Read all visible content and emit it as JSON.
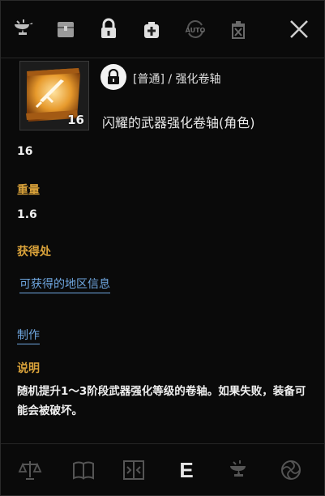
{
  "header": {
    "category": "[普通] / 强化卷轴",
    "item_name": "闪耀的武器强化卷轴(角色)",
    "item_count": "16",
    "auto_label": "AUTO"
  },
  "stats": {
    "quantity": "16",
    "weight_label": "重量",
    "weight_value": "1.6",
    "source_label": "获得处",
    "source_link": "可获得的地区信息",
    "craft_link": "制作",
    "desc_label": "说明",
    "desc_text": "随机提升1～3阶段武器强化等级的卷轴。如果失败，装备可能会被破坏。"
  },
  "bottom": {
    "e_label": "E"
  },
  "colors": {
    "label": "#d9a23a",
    "link": "#6fa7e0",
    "icon": "#bdbdbd",
    "scroll": "#e79a2c"
  }
}
